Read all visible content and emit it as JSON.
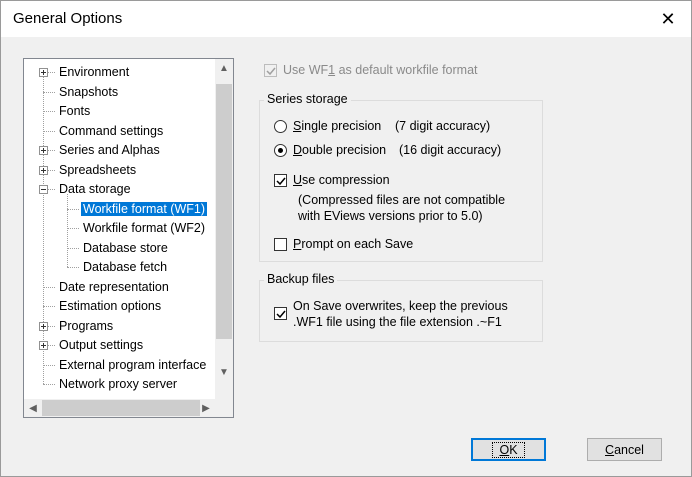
{
  "window": {
    "title": "General Options",
    "close_glyph": "✕"
  },
  "tree": {
    "items": [
      {
        "label": "Environment",
        "expander": "plus"
      },
      {
        "label": "Snapshots"
      },
      {
        "label": "Fonts"
      },
      {
        "label": "Command settings"
      },
      {
        "label": "Series and Alphas",
        "expander": "plus"
      },
      {
        "label": "Spreadsheets",
        "expander": "plus"
      },
      {
        "label": "Data storage",
        "expander": "minus"
      },
      {
        "label": "Workfile format (WF1)",
        "selected": true,
        "child": true
      },
      {
        "label": "Workfile format (WF2)",
        "child": true
      },
      {
        "label": "Database store",
        "child": true
      },
      {
        "label": "Database fetch",
        "child": true
      },
      {
        "label": "Date representation"
      },
      {
        "label": "Estimation options"
      },
      {
        "label": "Programs",
        "expander": "plus"
      },
      {
        "label": "Output settings",
        "expander": "plus"
      },
      {
        "label": "External program interface"
      },
      {
        "label": "Network proxy server"
      }
    ],
    "scroll_up": "▲",
    "scroll_down": "▼",
    "scroll_left": "◀",
    "scroll_right": "▶"
  },
  "options": {
    "default_format": {
      "prefix": "Use WF",
      "accel": "1",
      "suffix": " as default workfile format",
      "checked": true,
      "disabled": true
    },
    "series_storage": {
      "title": "Series storage",
      "single": {
        "accel": "S",
        "label": "ingle precision",
        "note": "(7 digit accuracy)",
        "selected": false
      },
      "double": {
        "accel": "D",
        "label": "ouble precision",
        "note": "(16 digit accuracy)",
        "selected": true
      },
      "compression": {
        "accel": "U",
        "label": "se compression",
        "checked": true
      },
      "compression_note_1": "(Compressed files are not compatible",
      "compression_note_2": "with EViews versions prior to 5.0)",
      "prompt": {
        "accel": "P",
        "label": "rompt on each Save",
        "checked": false
      }
    },
    "backup": {
      "title": "Backup files",
      "line1": "On Save overwrites, keep the previous",
      "line2": ".WF1 file using the file extension .~F1",
      "checked": true
    }
  },
  "buttons": {
    "ok": {
      "accel": "O",
      "rest": "K"
    },
    "cancel": {
      "accel": "C",
      "rest": "ancel"
    }
  }
}
